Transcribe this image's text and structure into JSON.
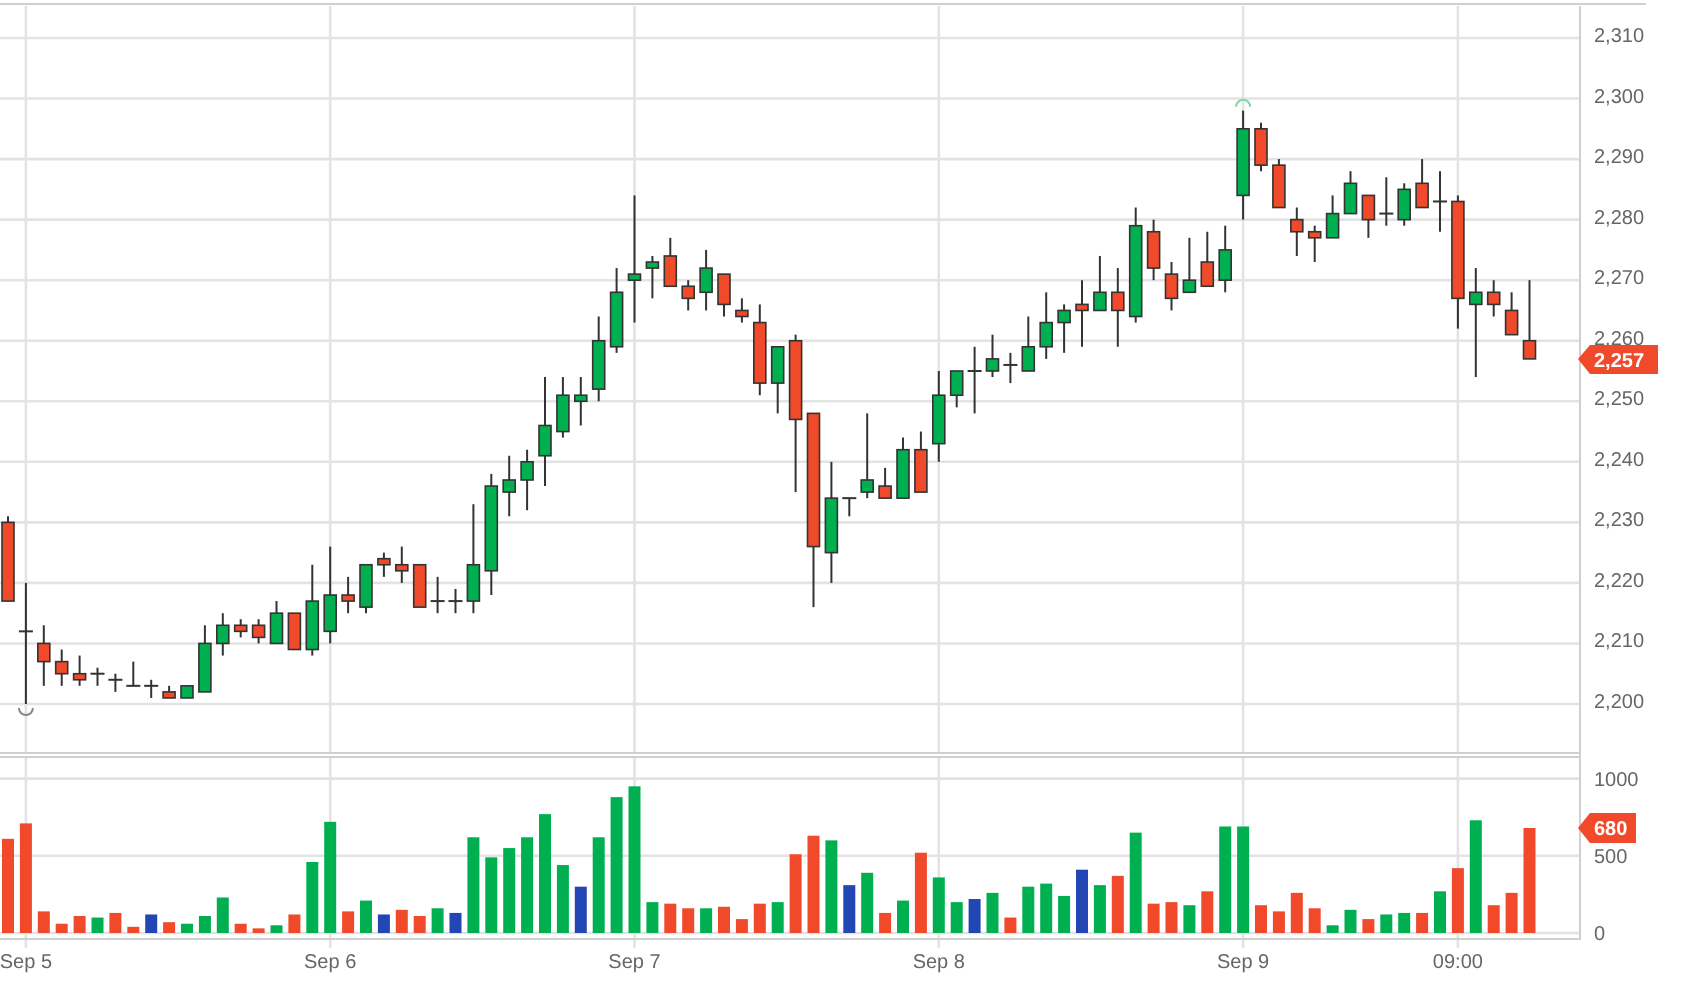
{
  "price_chart": {
    "chart_data": {
      "type": "candlestick",
      "grid": true,
      "ylim": [
        2200,
        2310
      ],
      "yticks": [
        {
          "value": 2200,
          "label": "2,200"
        },
        {
          "value": 2210,
          "label": "2,210"
        },
        {
          "value": 2220,
          "label": "2,220"
        },
        {
          "value": 2230,
          "label": "2,230"
        },
        {
          "value": 2240,
          "label": "2,240"
        },
        {
          "value": 2250,
          "label": "2,250"
        },
        {
          "value": 2260,
          "label": "2,260"
        },
        {
          "value": 2270,
          "label": "2,270"
        },
        {
          "value": 2280,
          "label": "2,280"
        },
        {
          "value": 2290,
          "label": "2,290"
        },
        {
          "value": 2300,
          "label": "2,300"
        },
        {
          "value": 2310,
          "label": "2,310"
        }
      ],
      "categories": [
        null,
        null,
        null,
        null,
        null,
        null,
        null,
        null,
        null,
        null,
        null,
        null,
        null,
        null,
        null,
        null,
        null,
        null,
        null,
        null,
        null,
        null,
        null,
        null,
        null,
        null,
        null,
        null,
        null,
        null,
        null,
        null,
        null,
        null,
        null,
        null,
        null,
        null,
        null,
        null,
        null,
        null,
        null,
        null,
        null,
        null,
        null,
        null,
        null,
        null,
        null,
        null,
        null,
        null,
        null,
        null,
        null,
        null,
        null,
        null,
        null,
        null,
        null,
        null,
        null,
        null,
        null,
        null,
        null,
        null,
        null,
        null,
        null,
        null,
        null,
        null,
        null,
        null,
        null,
        null,
        null,
        null,
        null,
        null,
        null,
        null
      ],
      "ohlc": [
        [
          2230,
          2231,
          2217,
          2217
        ],
        [
          2212,
          2220,
          2200,
          2212
        ],
        [
          2210,
          2213,
          2203,
          2207
        ],
        [
          2207,
          2209,
          2203,
          2205
        ],
        [
          2205,
          2208,
          2203,
          2204
        ],
        [
          2205,
          2206,
          2203,
          2205
        ],
        [
          2204,
          2205,
          2202,
          2204
        ],
        [
          2203,
          2207,
          2203,
          2203
        ],
        [
          2203,
          2204,
          2201,
          2203
        ],
        [
          2202,
          2203,
          2201,
          2201
        ],
        [
          2201,
          2203,
          2201,
          2203
        ],
        [
          2202,
          2213,
          2202,
          2210
        ],
        [
          2210,
          2215,
          2208,
          2213
        ],
        [
          2213,
          2214,
          2211,
          2212
        ],
        [
          2213,
          2214,
          2210,
          2211
        ],
        [
          2210,
          2217,
          2210,
          2215
        ],
        [
          2215,
          2215,
          2209,
          2209
        ],
        [
          2209,
          2223,
          2208,
          2217
        ],
        [
          2212,
          2226,
          2210,
          2218
        ],
        [
          2218,
          2221,
          2215,
          2217
        ],
        [
          2216,
          2223,
          2215,
          2223
        ],
        [
          2224,
          2225,
          2221,
          2223
        ],
        [
          2223,
          2226,
          2220,
          2222
        ],
        [
          2223,
          2223,
          2216,
          2216
        ],
        [
          2217,
          2221,
          2215,
          2217
        ],
        [
          2217,
          2219,
          2215,
          2217
        ],
        [
          2217,
          2233,
          2215,
          2223
        ],
        [
          2222,
          2238,
          2218,
          2236
        ],
        [
          2235,
          2241,
          2231,
          2237
        ],
        [
          2237,
          2242,
          2232,
          2240
        ],
        [
          2241,
          2254,
          2236,
          2246
        ],
        [
          2245,
          2254,
          2244,
          2251
        ],
        [
          2250,
          2254,
          2246,
          2251
        ],
        [
          2252,
          2264,
          2250,
          2260
        ],
        [
          2259,
          2272,
          2258,
          2268
        ],
        [
          2270,
          2284,
          2263,
          2271
        ],
        [
          2272,
          2274,
          2267,
          2273
        ],
        [
          2274,
          2277,
          2269,
          2269
        ],
        [
          2269,
          2270,
          2265,
          2267
        ],
        [
          2268,
          2275,
          2265,
          2272
        ],
        [
          2271,
          2271,
          2264,
          2266
        ],
        [
          2265,
          2267,
          2263,
          2264
        ],
        [
          2263,
          2266,
          2251,
          2253
        ],
        [
          2253,
          2259,
          2248,
          2259
        ],
        [
          2260,
          2261,
          2235,
          2247
        ],
        [
          2248,
          2248,
          2216,
          2226
        ],
        [
          2225,
          2240,
          2220,
          2234
        ],
        [
          2234,
          2234,
          2231,
          2234
        ],
        [
          2235,
          2248,
          2234,
          2237
        ],
        [
          2236,
          2239,
          2234,
          2234
        ],
        [
          2234,
          2244,
          2234,
          2242
        ],
        [
          2242,
          2245,
          2235,
          2235
        ],
        [
          2243,
          2255,
          2240,
          2251
        ],
        [
          2251,
          2255,
          2249,
          2255
        ],
        [
          2255,
          2259,
          2248,
          2255
        ],
        [
          2255,
          2261,
          2254,
          2257
        ],
        [
          2256,
          2258,
          2253,
          2256
        ],
        [
          2255,
          2264,
          2255,
          2259
        ],
        [
          2259,
          2268,
          2257,
          2263
        ],
        [
          2263,
          2266,
          2258,
          2265
        ],
        [
          2266,
          2270,
          2259,
          2265
        ],
        [
          2265,
          2274,
          2265,
          2268
        ],
        [
          2268,
          2272,
          2259,
          2265
        ],
        [
          2264,
          2282,
          2263,
          2279
        ],
        [
          2278,
          2280,
          2270,
          2272
        ],
        [
          2271,
          2273,
          2265,
          2267
        ],
        [
          2268,
          2277,
          2268,
          2270
        ],
        [
          2273,
          2278,
          2269,
          2269
        ],
        [
          2270,
          2279,
          2268,
          2275
        ],
        [
          2284,
          2298,
          2280,
          2295
        ],
        [
          2295,
          2296,
          2288,
          2289
        ],
        [
          2289,
          2290,
          2282,
          2282
        ],
        [
          2280,
          2282,
          2274,
          2278
        ],
        [
          2278,
          2279,
          2273,
          2277
        ],
        [
          2277,
          2284,
          2277,
          2281
        ],
        [
          2281,
          2288,
          2281,
          2286
        ],
        [
          2284,
          2284,
          2277,
          2280
        ],
        [
          2281,
          2287,
          2279,
          2281
        ],
        [
          2280,
          2286,
          2279,
          2285
        ],
        [
          2286,
          2290,
          2282,
          2282
        ],
        [
          2283,
          2288,
          2278,
          2283
        ],
        [
          2283,
          2284,
          2262,
          2267
        ],
        [
          2266,
          2272,
          2254,
          2268
        ],
        [
          2268,
          2270,
          2264,
          2266
        ],
        [
          2265,
          2268,
          2261,
          2261
        ],
        [
          2260,
          2270,
          2257,
          2257
        ]
      ]
    },
    "last_price_tag": "2,257"
  },
  "volume_chart": {
    "chart_data": {
      "type": "bar",
      "grid": true,
      "ylim": [
        0,
        1000
      ],
      "yticks": [
        {
          "value": 0,
          "label": "0"
        },
        {
          "value": 500,
          "label": "500"
        },
        {
          "value": 1000,
          "label": "1000"
        }
      ],
      "categories": [
        null,
        "Sep 5",
        null,
        null,
        null,
        null,
        null,
        null,
        null,
        null,
        null,
        null,
        null,
        null,
        null,
        null,
        null,
        null,
        "Sep 6",
        null,
        null,
        null,
        null,
        null,
        null,
        null,
        null,
        null,
        null,
        null,
        null,
        null,
        null,
        null,
        null,
        "Sep 7",
        null,
        null,
        null,
        null,
        null,
        null,
        null,
        null,
        null,
        null,
        null,
        null,
        null,
        null,
        null,
        null,
        "Sep 8",
        null,
        null,
        null,
        null,
        null,
        null,
        null,
        null,
        null,
        null,
        null,
        null,
        null,
        null,
        null,
        null,
        "Sep 9",
        null,
        null,
        null,
        null,
        null,
        null,
        null,
        null,
        null,
        null,
        null,
        "09:00",
        null,
        null,
        null,
        null
      ],
      "series": [
        {
          "color": "#00b050",
          "values": [
            null,
            null,
            null,
            null,
            null,
            100,
            null,
            null,
            null,
            null,
            60,
            110,
            230,
            null,
            null,
            50,
            null,
            460,
            720,
            null,
            210,
            null,
            null,
            null,
            160,
            null,
            620,
            490,
            550,
            620,
            770,
            440,
            null,
            620,
            880,
            950,
            200,
            null,
            null,
            160,
            null,
            null,
            null,
            200,
            null,
            null,
            600,
            null,
            390,
            null,
            210,
            null,
            360,
            200,
            null,
            260,
            null,
            300,
            320,
            240,
            null,
            310,
            null,
            650,
            null,
            null,
            180,
            null,
            690,
            690,
            null,
            null,
            null,
            null,
            50,
            150,
            null,
            120,
            130,
            null,
            270,
            null,
            730,
            null,
            null,
            null
          ]
        },
        {
          "color": "#f04a2a",
          "values": [
            610,
            710,
            140,
            60,
            110,
            null,
            130,
            40,
            null,
            70,
            null,
            null,
            null,
            60,
            30,
            null,
            120,
            null,
            null,
            140,
            null,
            null,
            150,
            110,
            null,
            null,
            null,
            null,
            null,
            null,
            null,
            null,
            null,
            null,
            null,
            null,
            null,
            190,
            160,
            null,
            170,
            90,
            190,
            null,
            510,
            630,
            null,
            null,
            null,
            130,
            null,
            520,
            null,
            null,
            null,
            null,
            100,
            null,
            null,
            null,
            null,
            null,
            370,
            null,
            190,
            200,
            null,
            270,
            null,
            null,
            180,
            140,
            260,
            160,
            null,
            null,
            90,
            null,
            null,
            130,
            null,
            420,
            null,
            180,
            260,
            680
          ]
        },
        {
          "color": "#2346b5",
          "values": [
            null,
            null,
            null,
            null,
            null,
            null,
            null,
            null,
            120,
            null,
            null,
            null,
            null,
            null,
            null,
            null,
            null,
            null,
            null,
            null,
            null,
            120,
            null,
            null,
            null,
            130,
            null,
            null,
            null,
            null,
            null,
            null,
            300,
            null,
            null,
            null,
            null,
            null,
            null,
            null,
            null,
            null,
            null,
            null,
            null,
            null,
            null,
            310,
            null,
            null,
            null,
            null,
            null,
            null,
            220,
            null,
            null,
            null,
            null,
            null,
            410,
            null,
            null,
            null,
            null,
            null,
            null,
            null,
            null,
            null,
            null,
            null,
            null,
            null,
            null,
            null,
            null,
            null,
            null,
            null,
            null,
            null,
            null,
            null,
            null,
            null
          ]
        }
      ]
    },
    "last_volume_tag": "680"
  }
}
